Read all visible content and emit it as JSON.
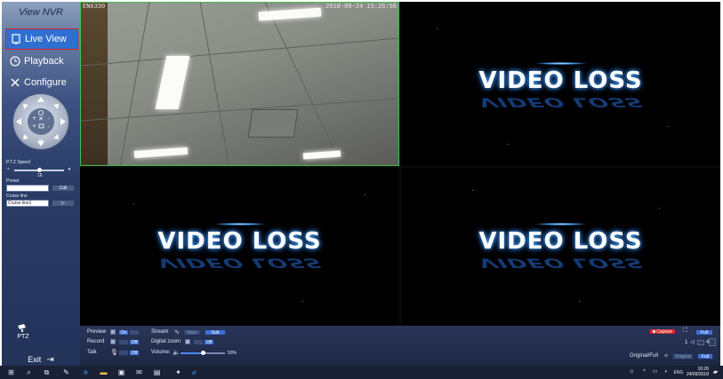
{
  "sidebar": {
    "brand": "View NVR",
    "nav": [
      {
        "label": "Live View",
        "icon": "monitor-icon"
      },
      {
        "label": "Playback",
        "icon": "clock-icon"
      },
      {
        "label": "Configure",
        "icon": "tools-icon"
      }
    ],
    "ptz_pad": {
      "center_label": "ok"
    },
    "ptz_speed": {
      "label": "P.T.Z Speed",
      "value": "16"
    },
    "preset": {
      "label": "Preset",
      "value": "",
      "button": "Call"
    },
    "cruise": {
      "label": "Cruise line",
      "value": "Cruise line1"
    },
    "ptz_button": "PTZ",
    "exit_label": "Exit"
  },
  "video": {
    "cam1": {
      "name": "EN6330",
      "timestamp": "2018-09-24 15:26:56"
    },
    "loss_text": "VIDEO LOSS"
  },
  "controls": {
    "preview": {
      "label": "Preview",
      "state": "On"
    },
    "stream": {
      "label": "Stream",
      "main": "Main",
      "sub": "Sub"
    },
    "record": {
      "label": "Record",
      "state": "Off"
    },
    "digital_zoom": {
      "label": "Digital zoom",
      "state": "Off"
    },
    "talk": {
      "label": "Talk",
      "state": "Off"
    },
    "volume": {
      "label": "Volume:",
      "value_text": "50%",
      "level": 0.5
    },
    "capture_label": "Capture",
    "full_label": "Full",
    "page": {
      "current": "1",
      "total": "4"
    },
    "original_full": {
      "label": "Original/Full",
      "original": "Original",
      "full": "Full"
    }
  },
  "taskbar": {
    "lang": "ENG",
    "time": "16:26",
    "date": "24/09/2018"
  }
}
